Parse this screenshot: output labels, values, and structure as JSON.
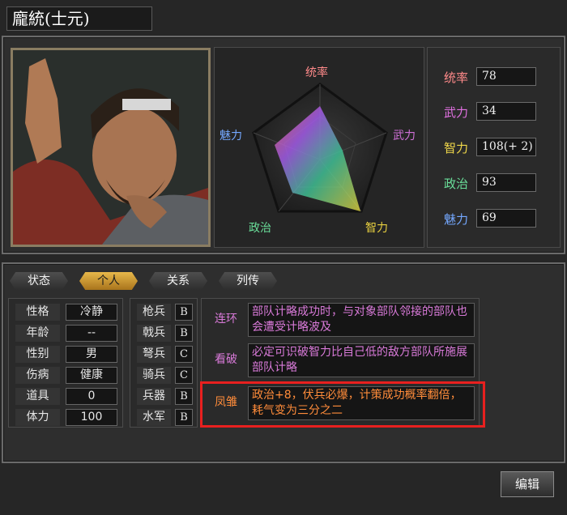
{
  "header": {
    "title": "龐統(士元)"
  },
  "radar": {
    "labels": {
      "lead": "统率",
      "war": "武力",
      "int": "智力",
      "pol": "政治",
      "cha": "魅力"
    }
  },
  "stats": [
    {
      "label": "统率",
      "value": "78",
      "color": "#ff8a8a"
    },
    {
      "label": "武力",
      "value": "34",
      "color": "#e070e0"
    },
    {
      "label": "智力",
      "value": "108(+ 2)",
      "color": "#f0d84a"
    },
    {
      "label": "政治",
      "value": "93",
      "color": "#6adf9a"
    },
    {
      "label": "魅力",
      "value": "69",
      "color": "#74a8ff"
    }
  ],
  "tabs": [
    {
      "label": "状态"
    },
    {
      "label": "个人"
    },
    {
      "label": "关系"
    },
    {
      "label": "列传"
    }
  ],
  "active_tab": "个人",
  "info": [
    {
      "label": "性格",
      "value": "冷静"
    },
    {
      "label": "年龄",
      "value": "--"
    },
    {
      "label": "性别",
      "value": "男"
    },
    {
      "label": "伤病",
      "value": "健康"
    },
    {
      "label": "道具",
      "value": "0"
    },
    {
      "label": "体力",
      "value": "100"
    }
  ],
  "aptitude": [
    {
      "label": "枪兵",
      "grade": "B"
    },
    {
      "label": "戟兵",
      "grade": "B"
    },
    {
      "label": "弩兵",
      "grade": "C"
    },
    {
      "label": "骑兵",
      "grade": "C"
    },
    {
      "label": "兵器",
      "grade": "B"
    },
    {
      "label": "水军",
      "grade": "B"
    }
  ],
  "skills": [
    {
      "name": "连环",
      "desc": "部队计略成功时，与对象部队邻接的部队也会遭受计略波及",
      "color": "#d97ad9"
    },
    {
      "name": "看破",
      "desc": "必定可识破智力比自己低的敌方部队所施展部队计略",
      "color": "#d97ad9"
    },
    {
      "name": "凤雏",
      "desc": "政治+8，伏兵必爆，计策成功概率翻倍，耗气变为三分之二",
      "color": "#ff8c3a"
    }
  ],
  "buttons": {
    "edit": "编辑"
  },
  "colors": {
    "accent": "#e8201f",
    "tab_active": "#d9a437"
  }
}
